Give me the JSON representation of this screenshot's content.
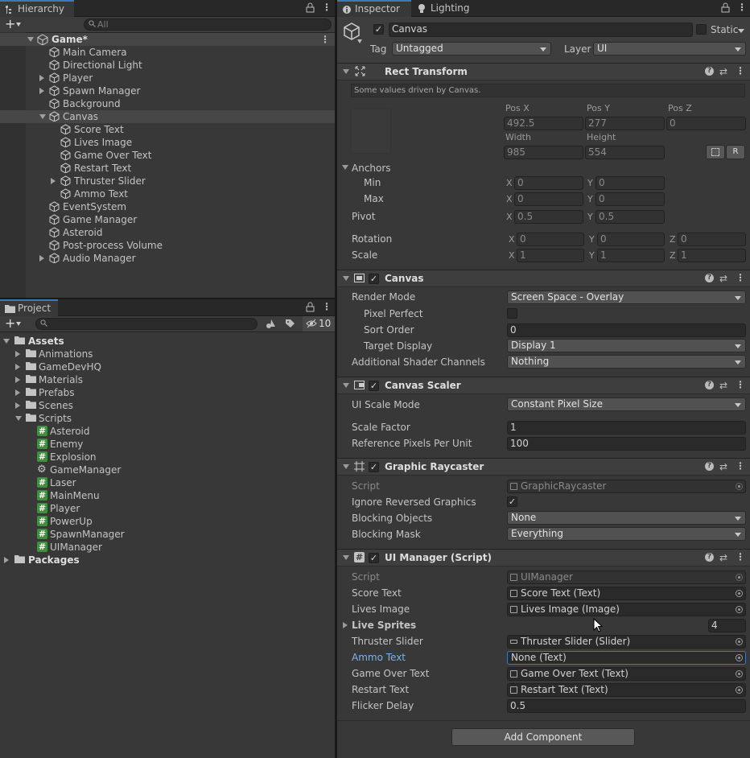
{
  "hierarchy": {
    "tab": "Hierarchy",
    "search_placeholder": "All",
    "scene": "Game*",
    "items": [
      {
        "label": "Main Camera"
      },
      {
        "label": "Directional Light"
      },
      {
        "label": "Player"
      },
      {
        "label": "Spawn Manager"
      },
      {
        "label": "Background"
      },
      {
        "label": "Canvas"
      },
      {
        "label": "Score Text"
      },
      {
        "label": "Lives Image"
      },
      {
        "label": "Game Over Text"
      },
      {
        "label": "Restart Text"
      },
      {
        "label": "Thruster Slider"
      },
      {
        "label": "Ammo Text"
      },
      {
        "label": "EventSystem"
      },
      {
        "label": "Game Manager"
      },
      {
        "label": "Asteroid"
      },
      {
        "label": "Post-process Volume"
      },
      {
        "label": "Audio Manager"
      }
    ]
  },
  "project": {
    "tab": "Project",
    "hidden_count": "10",
    "assets": "Assets",
    "folders": [
      "Animations",
      "GameDevHQ",
      "Materials",
      "Prefabs",
      "Scenes",
      "Scripts"
    ],
    "scripts": [
      "Asteroid",
      "Enemy",
      "Explosion",
      "GameManager",
      "Laser",
      "MainMenu",
      "Player",
      "PowerUp",
      "SpawnManager",
      "UIManager"
    ],
    "packages": "Packages"
  },
  "inspector": {
    "tab": "Inspector",
    "tab2": "Lighting",
    "object_name": "Canvas",
    "static_label": "Static",
    "tag_label": "Tag",
    "tag_value": "Untagged",
    "layer_label": "Layer",
    "layer_value": "UI",
    "rect": {
      "title": "Rect Transform",
      "note": "Some values driven by Canvas.",
      "posx_l": "Pos X",
      "posy_l": "Pos Y",
      "posz_l": "Pos Z",
      "posx": "492.5",
      "posy": "277",
      "posz": "0",
      "width_l": "Width",
      "height_l": "Height",
      "width": "985",
      "height": "554",
      "r_btn": "R",
      "anchors": "Anchors",
      "min": "Min",
      "max": "Max",
      "min_x": "0",
      "min_y": "0",
      "max_x": "0",
      "max_y": "0",
      "pivot": "Pivot",
      "pivot_x": "0.5",
      "pivot_y": "0.5",
      "rotation": "Rotation",
      "rot_x": "0",
      "rot_y": "0",
      "rot_z": "0",
      "scale": "Scale",
      "scale_x": "1",
      "scale_y": "1",
      "scale_z": "1",
      "x": "X",
      "y": "Y",
      "z": "Z"
    },
    "canvas": {
      "title": "Canvas",
      "render_mode_l": "Render Mode",
      "render_mode": "Screen Space - Overlay",
      "pixel_perfect_l": "Pixel Perfect",
      "sort_order_l": "Sort Order",
      "sort_order": "0",
      "target_display_l": "Target Display",
      "target_display": "Display 1",
      "shader_channels_l": "Additional Shader Channels",
      "shader_channels": "Nothing"
    },
    "scaler": {
      "title": "Canvas Scaler",
      "mode_l": "UI Scale Mode",
      "mode": "Constant Pixel Size",
      "factor_l": "Scale Factor",
      "factor": "1",
      "ppu_l": "Reference Pixels Per Unit",
      "ppu": "100"
    },
    "raycaster": {
      "title": "Graphic Raycaster",
      "script_l": "Script",
      "script": "GraphicRaycaster",
      "ignore_l": "Ignore Reversed Graphics",
      "blocking_l": "Blocking Objects",
      "blocking": "None",
      "mask_l": "Blocking Mask",
      "mask": "Everything"
    },
    "uimanager": {
      "title": "UI Manager (Script)",
      "script_l": "Script",
      "script": "UIManager",
      "score_l": "Score Text",
      "score": "Score Text (Text)",
      "lives_l": "Lives Image",
      "lives": "Lives Image (Image)",
      "sprites_l": "Live Sprites",
      "sprites": "4",
      "thruster_l": "Thruster Slider",
      "thruster": "Thruster Slider (Slider)",
      "ammo_l": "Ammo Text",
      "ammo": "None (Text)",
      "gameover_l": "Game Over Text",
      "gameover": "Game Over Text (Text)",
      "restart_l": "Restart Text",
      "restart": "Restart Text (Text)",
      "flicker_l": "Flicker Delay",
      "flicker": "0.5"
    },
    "add_component": "Add Component"
  },
  "colors": {
    "accent": "#3a79bb",
    "highlight_label": "#7fb1ea",
    "script_icon": "#3e8f3e"
  }
}
